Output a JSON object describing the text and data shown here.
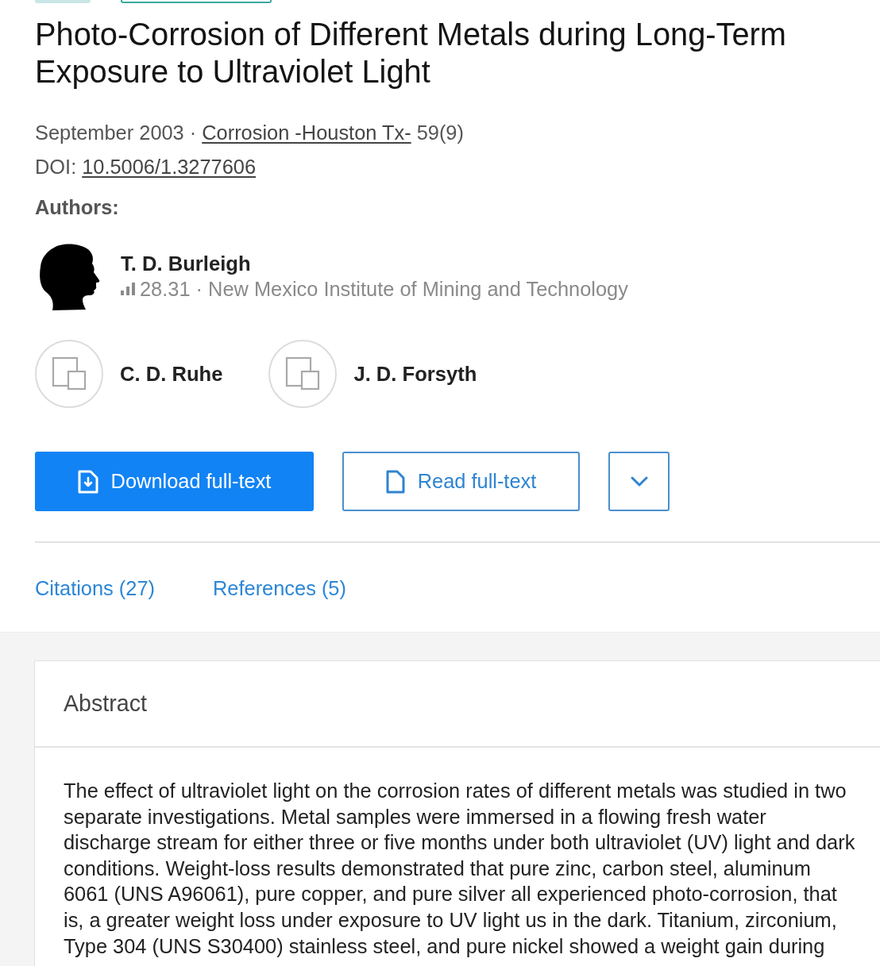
{
  "badges": [
    {
      "kind": "filled"
    },
    {
      "kind": "outlined"
    }
  ],
  "title": "Photo-Corrosion of Different Metals during Long-Term Exposure to Ultraviolet Light",
  "meta": {
    "date": "September 2003",
    "separator": "·",
    "journal": "Corrosion -Houston Tx-",
    "issue": "59(9)"
  },
  "doi": {
    "label": "DOI:",
    "value": "10.5006/1.3277606"
  },
  "authors_heading": "Authors:",
  "authors": [
    {
      "kind": "silhouette",
      "name": "T. D. Burleigh",
      "score": "28.31",
      "separator": "·",
      "affiliation": "New Mexico Institute of Mining and Technology"
    },
    {
      "kind": "placeholder",
      "name": "C. D. Ruhe"
    },
    {
      "kind": "placeholder",
      "name": "J. D. Forsyth"
    }
  ],
  "actions": [
    {
      "kind": "primary",
      "label": "Download full-text"
    },
    {
      "kind": "outline",
      "label": "Read full-text"
    },
    {
      "kind": "menu"
    }
  ],
  "tabs": [
    {
      "label": "Citations (27)"
    },
    {
      "label": "References (5)"
    }
  ],
  "abstract": {
    "heading": "Abstract",
    "text": "The effect of ultraviolet light on the corrosion rates of different metals was studied in two separate investigations. Metal samples were immersed in a flowing fresh water discharge stream for either three or five months under both ultraviolet (UV) light and dark conditions. Weight-loss results demonstrated that pure zinc, carbon steel, aluminum 6061 (UNS A96061), pure copper, and pure silver all experienced photo-corrosion, that is, a greater weight loss under exposure to UV light us in the dark. Titanium, zirconium, Type 304 (UNS S30400) stainless steel, and pure nickel showed a weight gain during"
  }
}
